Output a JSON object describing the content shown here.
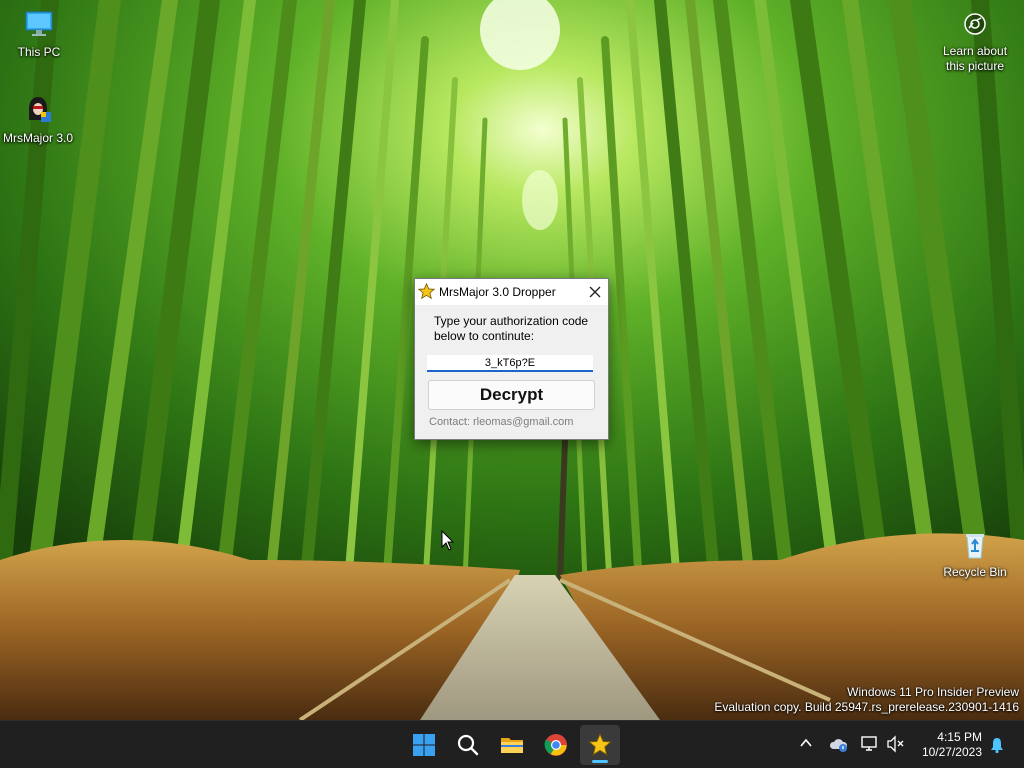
{
  "desktop": {
    "icons": [
      {
        "label": "This PC",
        "icon": "monitor-icon"
      },
      {
        "label": "MrsMajor 3.0",
        "icon": "hooded-figure-icon"
      },
      {
        "label": "Recycle Bin",
        "icon": "recycle-bin-icon"
      }
    ],
    "spotlight": {
      "label": "Learn about this picture",
      "icon": "camera-icon"
    },
    "watermark": {
      "line1": "Windows 11 Pro Insider Preview",
      "line2": "Evaluation copy. Build 25947.rs_prerelease.230901-1416"
    }
  },
  "dialog": {
    "title": "MrsMajor 3.0 Dropper",
    "title_icon": "star-icon",
    "prompt": "Type your authorization code below to continute:",
    "code_value": "3_kT6p?E",
    "decrypt_label": "Decrypt",
    "contact": "Contact: rleomas@gmail.com",
    "close_icon": "close-icon"
  },
  "taskbar": {
    "apps": [
      {
        "name": "Start",
        "icon": "windows-logo-icon"
      },
      {
        "name": "Search",
        "icon": "search-icon"
      },
      {
        "name": "File Explorer",
        "icon": "folder-icon"
      },
      {
        "name": "Google Chrome",
        "icon": "chrome-icon"
      },
      {
        "name": "MrsMajor 3.0 Dropper",
        "icon": "star-icon",
        "running": true
      }
    ],
    "tray": {
      "time": "4:15 PM",
      "date": "10/27/2023"
    }
  },
  "colors": {
    "accent": "#1d63c9",
    "taskbar_bg": "#202020",
    "running_indicator": "#4cc2ff"
  }
}
